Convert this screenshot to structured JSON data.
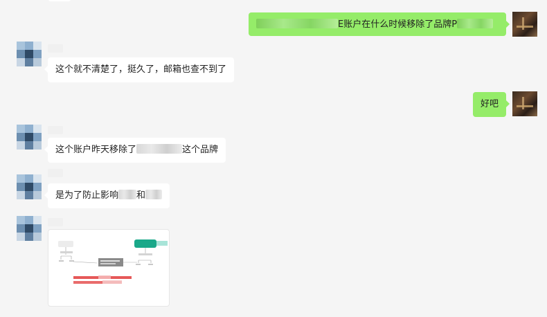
{
  "messages": [
    {
      "id": 1,
      "side": "out",
      "text": "E账户在什么时候移除了品牌P"
    },
    {
      "id": 2,
      "side": "in",
      "text": "这个就不清楚了，挺久了，邮箱也查不到了"
    },
    {
      "id": 3,
      "side": "out",
      "text": "好吧"
    },
    {
      "id": 4,
      "side": "in",
      "text_before": "这个账户昨天移除了",
      "text_after": "这个品牌"
    },
    {
      "id": 5,
      "side": "in",
      "text_before": "是为了防止影响",
      "text_mid": "和"
    },
    {
      "id": 6,
      "side": "in",
      "type": "image"
    }
  ],
  "colors": {
    "background": "#f5f5f5",
    "incoming_bubble": "#ffffff",
    "outgoing_bubble": "#95ec69",
    "image_red_text": "#e23b3b",
    "image_teal_node": "#1aa889"
  },
  "icons": {
    "contact_avatar": "pixelated-avatar-icon",
    "self_avatar": "photo-avatar-icon"
  }
}
